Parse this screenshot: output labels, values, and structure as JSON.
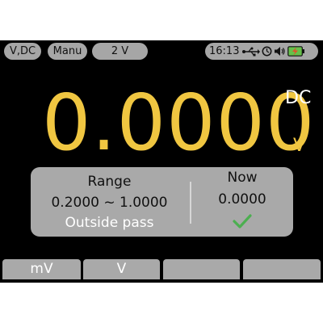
{
  "top_bar": {
    "function": "V,DC",
    "trigger_mode": "Manu",
    "range": "2 V",
    "time": "16:13"
  },
  "display": {
    "reading": "0.0000",
    "mode": "DC",
    "unit": "V"
  },
  "limit_panel": {
    "range_title": "Range",
    "range_value": "0.2000 ~ 1.0000",
    "status": "Outside pass",
    "now_title": "Now",
    "now_value": "0.0000"
  },
  "softkeys": [
    "mV",
    "V",
    "",
    ""
  ],
  "icons": {
    "usb": "usb-icon",
    "timer": "clock-icon",
    "speaker": "speaker-icon",
    "battery": "battery-icon",
    "pass": "check-icon"
  },
  "colors": {
    "reading": "#f0c641",
    "pass_check": "#4caf50",
    "battery_charge": "#e84b2a",
    "battery_body": "#66c04a"
  }
}
